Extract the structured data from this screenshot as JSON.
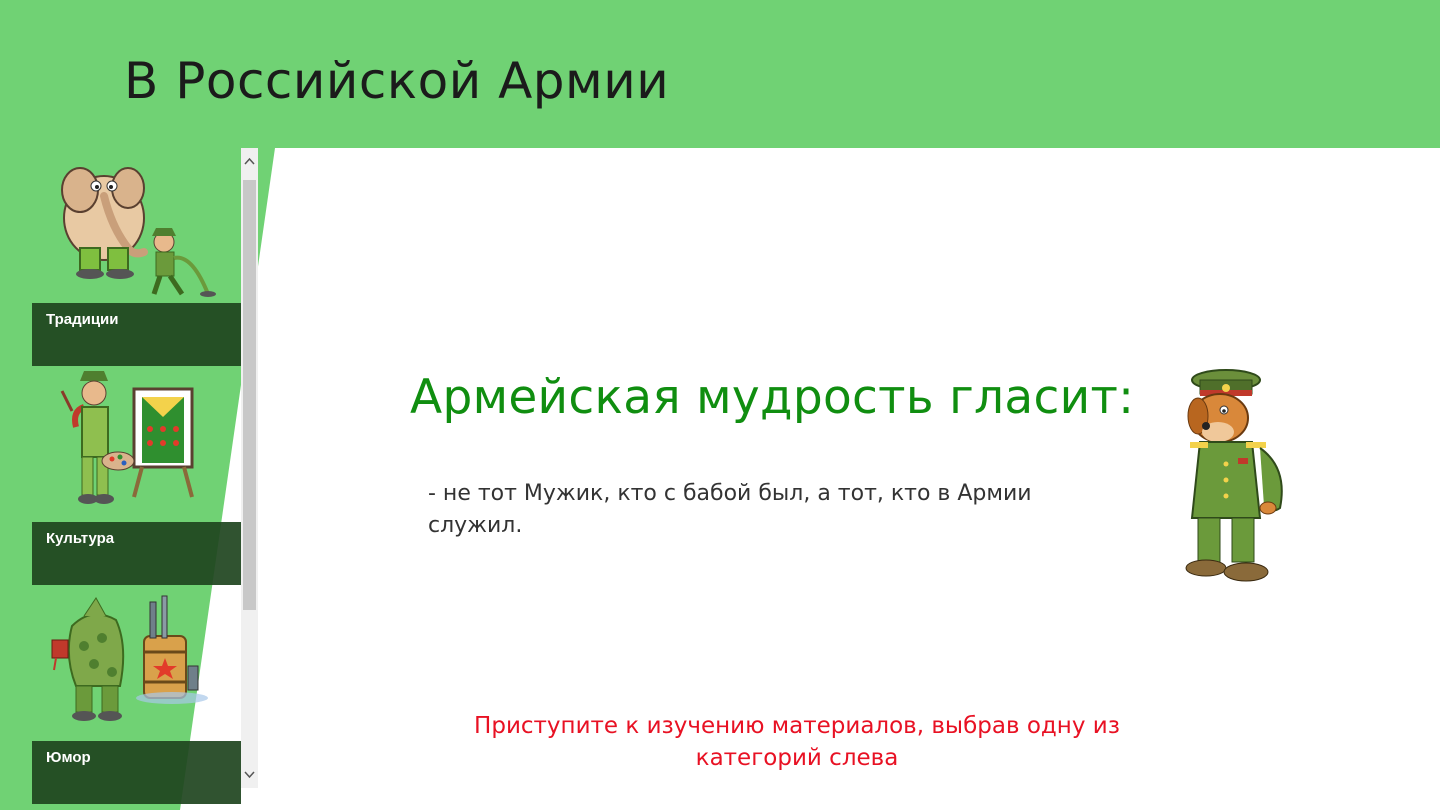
{
  "header": {
    "title": "В Российской Армии"
  },
  "sidebar": {
    "categories": [
      {
        "label": "Традиции",
        "art": "elephant-and-soldier-icon"
      },
      {
        "label": "Культура",
        "art": "soldier-painter-icon"
      },
      {
        "label": "Юмор",
        "art": "soldier-with-barrel-icon"
      }
    ]
  },
  "main": {
    "heading": "Армейская мудрость гласит:",
    "quote": "- не тот Мужик, кто с бабой был, а тот, кто в Армии служил.",
    "art": "dog-officer-icon",
    "instruction": "Приступите к изучению материалов, выбрав одну из категорий слева"
  },
  "colors": {
    "header_bg": "#70d274",
    "heading": "#108e10",
    "instruction": "#e81123",
    "label_bar": "#1e441e"
  }
}
